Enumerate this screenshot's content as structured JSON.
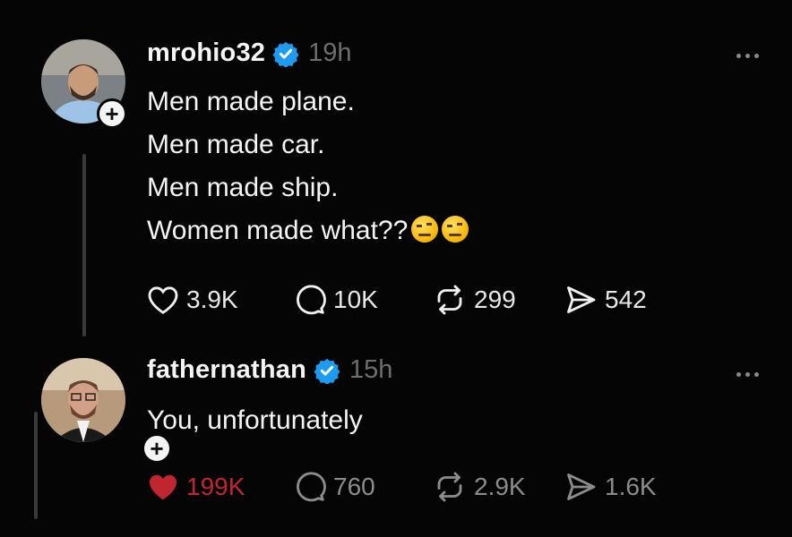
{
  "posts": [
    {
      "username": "mrohio32",
      "time": "19h",
      "lines": [
        "Men made plane.",
        "Men made car.",
        "Men made ship.",
        "Women made what??"
      ],
      "emojis": [
        "raised-eyebrow-emoji",
        "raised-eyebrow-emoji"
      ],
      "stats": {
        "likes": "3.9K",
        "comments": "10K",
        "reposts": "299",
        "shares": "542"
      },
      "liked": false
    },
    {
      "username": "fathernathan",
      "time": "15h",
      "lines": [
        "You, unfortunately"
      ],
      "stats": {
        "likes": "199K",
        "comments": "760",
        "reposts": "2.9K",
        "shares": "1.6K"
      },
      "liked": true
    }
  ],
  "colors": {
    "verified": "#1d9bf0",
    "liked": "#c0262d",
    "background": "#050505"
  }
}
